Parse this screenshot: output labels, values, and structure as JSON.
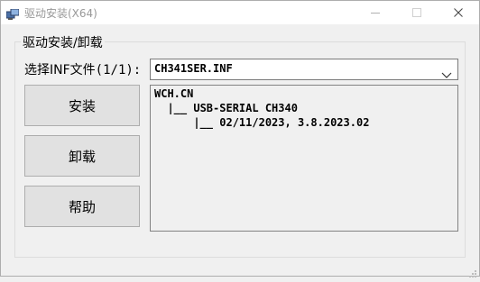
{
  "window": {
    "title": "驱动安装(X64)"
  },
  "group": {
    "label": "驱动安装/卸载"
  },
  "inf": {
    "label_prefix": "选择INF文件",
    "label_count": "(1/1):",
    "selected": "CH341SER.INF"
  },
  "buttons": {
    "install": "安装",
    "uninstall": "卸载",
    "help": "帮助"
  },
  "info": {
    "line1": "WCH.CN",
    "line2": "  |__ USB-SERIAL CH340",
    "line3": "      |__ 02/11/2023, 3.8.2023.02"
  },
  "icons": {
    "app": "driver-setup-icon",
    "minimize": "minimize-icon",
    "maximize": "maximize-icon",
    "close": "close-icon",
    "dropdown": "chevron-down-icon"
  }
}
